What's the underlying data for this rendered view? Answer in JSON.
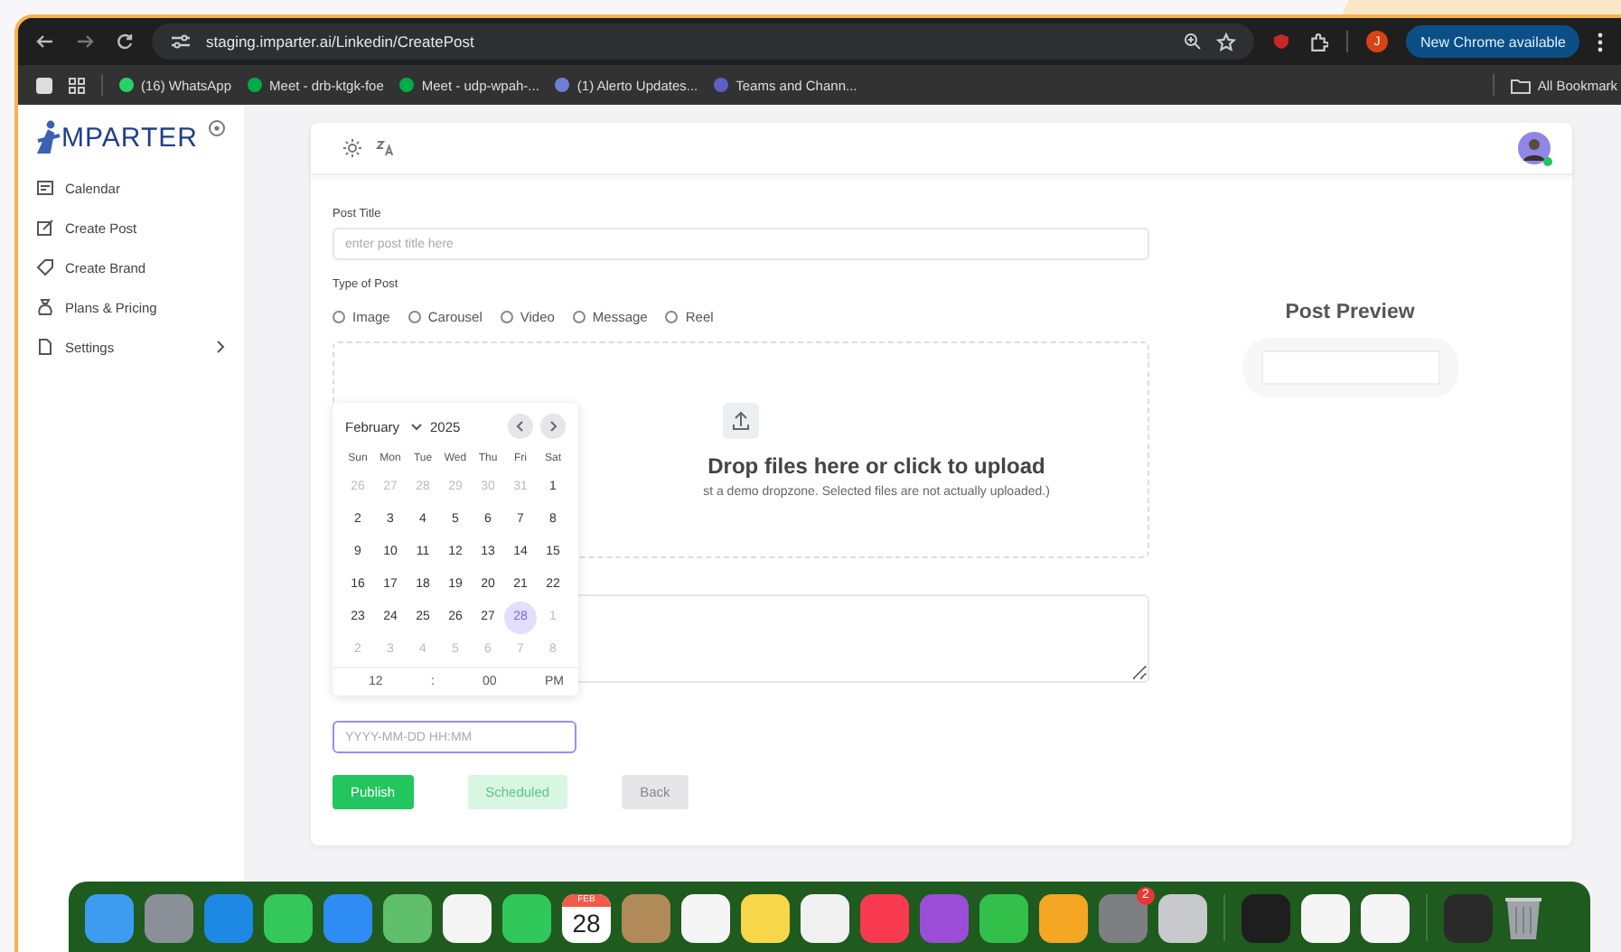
{
  "browser": {
    "url": "staging.imparter.ai/Linkedin/CreatePost",
    "profile_initial": "J",
    "update_button": "New Chrome available",
    "bookmarks": [
      {
        "label": "(16) WhatsApp",
        "color": "#25d366"
      },
      {
        "label": "Meet - drb-ktgk-foe",
        "color": "#00ac47"
      },
      {
        "label": "Meet - udp-wpah-...",
        "color": "#00ac47"
      },
      {
        "label": "(1) Alerto Updates...",
        "color": "#6b7fd7"
      },
      {
        "label": "Teams and Chann...",
        "color": "#5b5fc7"
      }
    ],
    "all_bookmarks": "All Bookmark"
  },
  "sidebar": {
    "logo": "MPARTER",
    "items": [
      {
        "label": "Calendar",
        "kind": "calendar",
        "expandable": false
      },
      {
        "label": "Create Post",
        "kind": "edit",
        "expandable": false
      },
      {
        "label": "Create Brand",
        "kind": "tag",
        "expandable": false
      },
      {
        "label": "Plans & Pricing",
        "kind": "bag",
        "expandable": false
      },
      {
        "label": "Settings",
        "kind": "file",
        "expandable": true
      }
    ]
  },
  "header": {
    "avatar_online": true
  },
  "form": {
    "title_label": "Post Title",
    "title_placeholder": "enter post title here",
    "type_label": "Type of Post",
    "post_types": [
      {
        "label": "Image",
        "selected": false
      },
      {
        "label": "Carousel",
        "selected": false
      },
      {
        "label": "Video",
        "selected": false
      },
      {
        "label": "Message",
        "selected": false
      },
      {
        "label": "Reel",
        "selected": false
      }
    ],
    "dropzone": {
      "title": "Drop files here or click to upload",
      "note": "st a demo dropzone. Selected files are not actually uploaded.)"
    },
    "date_placeholder": "YYYY-MM-DD HH:MM",
    "buttons": [
      {
        "label": "Publish",
        "kind": "primary"
      },
      {
        "label": "Scheduled",
        "kind": "soft"
      },
      {
        "label": "Back",
        "kind": "muted"
      }
    ]
  },
  "calendar": {
    "month": "February",
    "year": "2025",
    "weekdays": [
      "Sun",
      "Mon",
      "Tue",
      "Wed",
      "Thu",
      "Fri",
      "Sat"
    ],
    "weeks": [
      [
        {
          "label": "26",
          "muted": true,
          "selected": false
        },
        {
          "label": "27",
          "muted": true,
          "selected": false
        },
        {
          "label": "28",
          "muted": true,
          "selected": false
        },
        {
          "label": "29",
          "muted": true,
          "selected": false
        },
        {
          "label": "30",
          "muted": true,
          "selected": false
        },
        {
          "label": "31",
          "muted": true,
          "selected": false
        },
        {
          "label": "1",
          "muted": false,
          "selected": false
        }
      ],
      [
        {
          "label": "2",
          "muted": false,
          "selected": false
        },
        {
          "label": "3",
          "muted": false,
          "selected": false
        },
        {
          "label": "4",
          "muted": false,
          "selected": false
        },
        {
          "label": "5",
          "muted": false,
          "selected": false
        },
        {
          "label": "6",
          "muted": false,
          "selected": false
        },
        {
          "label": "7",
          "muted": false,
          "selected": false
        },
        {
          "label": "8",
          "muted": false,
          "selected": false
        }
      ],
      [
        {
          "label": "9",
          "muted": false,
          "selected": false
        },
        {
          "label": "10",
          "muted": false,
          "selected": false
        },
        {
          "label": "11",
          "muted": false,
          "selected": false
        },
        {
          "label": "12",
          "muted": false,
          "selected": false
        },
        {
          "label": "13",
          "muted": false,
          "selected": false
        },
        {
          "label": "14",
          "muted": false,
          "selected": false
        },
        {
          "label": "15",
          "muted": false,
          "selected": false
        }
      ],
      [
        {
          "label": "16",
          "muted": false,
          "selected": false
        },
        {
          "label": "17",
          "muted": false,
          "selected": false
        },
        {
          "label": "18",
          "muted": false,
          "selected": false
        },
        {
          "label": "19",
          "muted": false,
          "selected": false
        },
        {
          "label": "20",
          "muted": false,
          "selected": false
        },
        {
          "label": "21",
          "muted": false,
          "selected": false
        },
        {
          "label": "22",
          "muted": false,
          "selected": false
        }
      ],
      [
        {
          "label": "23",
          "muted": false,
          "selected": false
        },
        {
          "label": "24",
          "muted": false,
          "selected": false
        },
        {
          "label": "25",
          "muted": false,
          "selected": false
        },
        {
          "label": "26",
          "muted": false,
          "selected": false
        },
        {
          "label": "27",
          "muted": false,
          "selected": false
        },
        {
          "label": "28",
          "muted": false,
          "selected": true
        },
        {
          "label": "1",
          "muted": true,
          "selected": false
        }
      ],
      [
        {
          "label": "2",
          "muted": true,
          "selected": false
        },
        {
          "label": "3",
          "muted": true,
          "selected": false
        },
        {
          "label": "4",
          "muted": true,
          "selected": false
        },
        {
          "label": "5",
          "muted": true,
          "selected": false
        },
        {
          "label": "6",
          "muted": true,
          "selected": false
        },
        {
          "label": "7",
          "muted": true,
          "selected": false
        },
        {
          "label": "8",
          "muted": true,
          "selected": false
        }
      ]
    ],
    "hour": "12",
    "separator": ":",
    "minute": "00",
    "meridiem": "PM"
  },
  "preview": {
    "title": "Post Preview"
  },
  "dock": [
    {
      "kind": "app",
      "color": "#3d9bf0"
    },
    {
      "kind": "app",
      "color": "#8a8f98"
    },
    {
      "kind": "app",
      "color": "#1e88e5"
    },
    {
      "kind": "app",
      "color": "#34c759"
    },
    {
      "kind": "app",
      "color": "#2f8cf5"
    },
    {
      "kind": "app",
      "color": "#5fbf6a"
    },
    {
      "kind": "app",
      "color": "#f4f4f4"
    },
    {
      "kind": "app",
      "color": "#30c85a"
    },
    {
      "kind": "calendar",
      "month": "FEB",
      "day": "28"
    },
    {
      "kind": "app",
      "color": "#b08a58"
    },
    {
      "kind": "app",
      "color": "#f5f5f5"
    },
    {
      "kind": "app",
      "color": "#f7d64a"
    },
    {
      "kind": "app",
      "color": "#f1f1f1"
    },
    {
      "kind": "app",
      "color": "#f9394f"
    },
    {
      "kind": "app",
      "color": "#9b4dd8"
    },
    {
      "kind": "app",
      "color": "#32c04b"
    },
    {
      "kind": "app",
      "color": "#f5a623"
    },
    {
      "kind": "app",
      "color": "#7d7f83",
      "badge": "2"
    },
    {
      "kind": "app",
      "color": "#c7c9cc"
    },
    {
      "kind": "separator"
    },
    {
      "kind": "app",
      "color": "#1e1e1e"
    },
    {
      "kind": "app",
      "color": "#f5f5f5"
    },
    {
      "kind": "app",
      "color": "#f5f5f5"
    },
    {
      "kind": "separator"
    },
    {
      "kind": "app",
      "color": "#2a2a2a"
    },
    {
      "kind": "trash"
    }
  ]
}
